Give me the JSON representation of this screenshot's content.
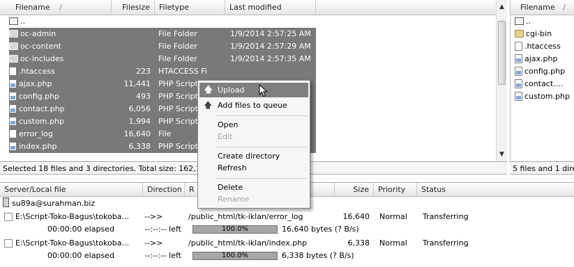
{
  "local_pane": {
    "headers": [
      "Filename",
      "Filesize",
      "Filetype",
      "Last modified"
    ],
    "sort_indicator": "/",
    "parent_dir": "..",
    "rows": [
      {
        "name": "oc-admin",
        "size": "",
        "type": "File Folder",
        "modified": "1/9/2014 2:57:25 AM",
        "icon": "folder-icon"
      },
      {
        "name": "oc-content",
        "size": "",
        "type": "File Folder",
        "modified": "1/9/2014 2:57:29 AM",
        "icon": "folder-icon"
      },
      {
        "name": "oc-includes",
        "size": "",
        "type": "File Folder",
        "modified": "1/9/2014 2:57:35 AM",
        "icon": "folder-icon"
      },
      {
        "name": ".htaccess",
        "size": "223",
        "type": "HTACCESS Fi",
        "modified": "",
        "icon": "generic-file-icon"
      },
      {
        "name": "ajax.php",
        "size": "11,441",
        "type": "PHP Script",
        "modified": "",
        "icon": "php-file-icon"
      },
      {
        "name": "config.php",
        "size": "493",
        "type": "PHP Script",
        "modified": "",
        "icon": "php-file-icon"
      },
      {
        "name": "contact.php",
        "size": "6,056",
        "type": "PHP Script",
        "modified": "",
        "icon": "php-file-icon"
      },
      {
        "name": "custom.php",
        "size": "1,994",
        "type": "PHP Script",
        "modified": "",
        "icon": "php-file-icon"
      },
      {
        "name": "error_log",
        "size": "16,640",
        "type": "File",
        "modified": "",
        "icon": "generic-file-icon"
      },
      {
        "name": "index.php",
        "size": "6,338",
        "type": "PHP Script",
        "modified": "",
        "icon": "php-file-icon"
      }
    ],
    "status": "Selected 18 files and 3 directories. Total size: 162,115"
  },
  "remote_pane": {
    "header": "Filename",
    "sort_indicator": "/",
    "parent_dir": "..",
    "rows": [
      {
        "name": "cgi-bin",
        "icon": "folder-icon"
      },
      {
        "name": ".htaccess",
        "icon": "generic-file-icon"
      },
      {
        "name": "ajax.php",
        "icon": "php-file-icon"
      },
      {
        "name": "config.php",
        "icon": "php-file-icon"
      },
      {
        "name": "contact.…",
        "icon": "php-file-icon"
      },
      {
        "name": "custom.php",
        "icon": "php-file-icon"
      }
    ],
    "status": "5 files and 1 dire"
  },
  "context_menu": {
    "items": [
      {
        "label": "Upload",
        "icon": "upload-arrow-icon",
        "highlighted": true,
        "disabled": false
      },
      {
        "label": "Add files to queue",
        "icon": "add-to-queue-icon",
        "highlighted": false,
        "disabled": false
      },
      {
        "label": "Open",
        "disabled": false
      },
      {
        "label": "Edit",
        "disabled": true
      },
      {
        "label": "Create directory",
        "disabled": false
      },
      {
        "label": "Refresh",
        "disabled": false
      },
      {
        "label": "Delete",
        "disabled": false
      },
      {
        "label": "Rename",
        "disabled": true
      }
    ]
  },
  "queue": {
    "headers": [
      "Server/Local file",
      "Direction",
      "R",
      "Size",
      "Priority",
      "Status"
    ],
    "server": "su89a@surahman.biz",
    "items": [
      {
        "local": "E:\\Script-Toko-Bagus\\tokoba...",
        "direction": "-->>",
        "remote": "/public_html/tk-iklan/error_log",
        "size": "16,640",
        "priority": "Normal",
        "status": "Transferring",
        "elapsed": "00:00:00 elapsed",
        "left": "--:--:-- left",
        "progress_label": "100.0%",
        "progress": 1.0,
        "bytes": "16,640 bytes (? B/s)"
      },
      {
        "local": "E:\\Script-Toko-Bagus\\tokoba...",
        "direction": "-->>",
        "remote": "/public_html/tk-iklan/index.php",
        "size": "6,338",
        "priority": "Normal",
        "status": "Transferring",
        "elapsed": "00:00:00 elapsed",
        "left": "--:--:-- left",
        "progress_label": "100.0%",
        "progress": 1.0,
        "bytes": "6,338 bytes (? B/s)"
      }
    ]
  }
}
